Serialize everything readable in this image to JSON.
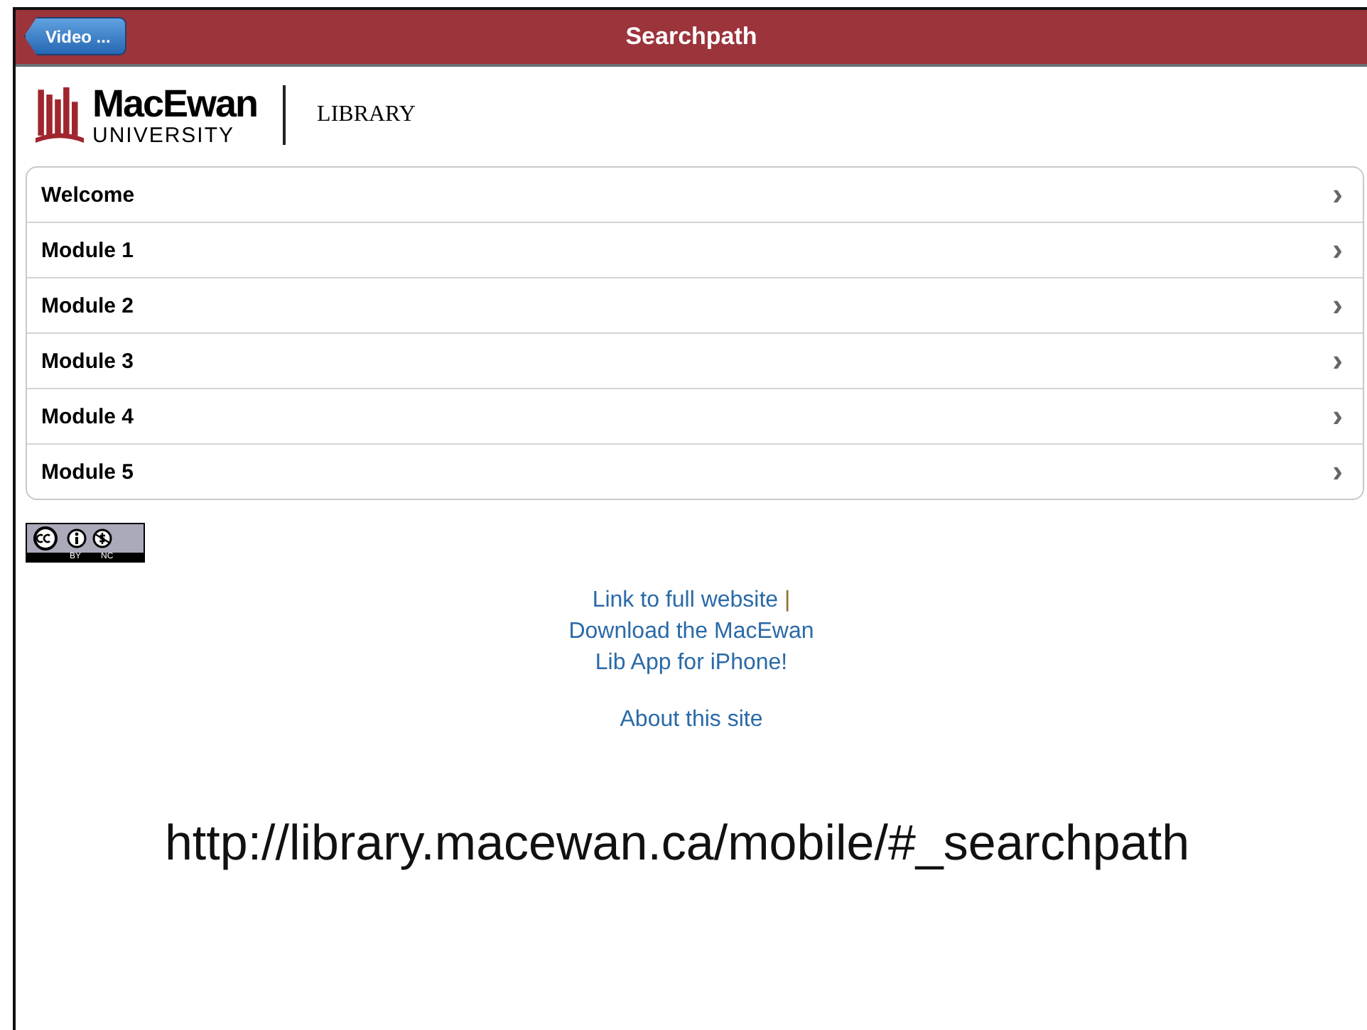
{
  "header": {
    "back_button": "Video ...",
    "title": "Searchpath"
  },
  "logo": {
    "name": "MacEwan",
    "subtitle": "UNIVERSITY",
    "section": "LIBRARY"
  },
  "menu": [
    {
      "label": "Welcome",
      "chevron": "›"
    },
    {
      "label": "Module 1",
      "chevron": "›"
    },
    {
      "label": "Module 2",
      "chevron": "›"
    },
    {
      "label": "Module 3",
      "chevron": "›"
    },
    {
      "label": "Module 4",
      "chevron": "›"
    },
    {
      "label": "Module 5",
      "chevron": "›"
    }
  ],
  "license_badge": {
    "labels": [
      "BY",
      "NC"
    ]
  },
  "footer": {
    "full_site_link": "Link to full website",
    "separator": "|",
    "app_link": "Download the MacEwan Lib App for iPhone!",
    "about_link": "About this site"
  },
  "caption": "http://library.macewan.ca/mobile/#_searchpath"
}
